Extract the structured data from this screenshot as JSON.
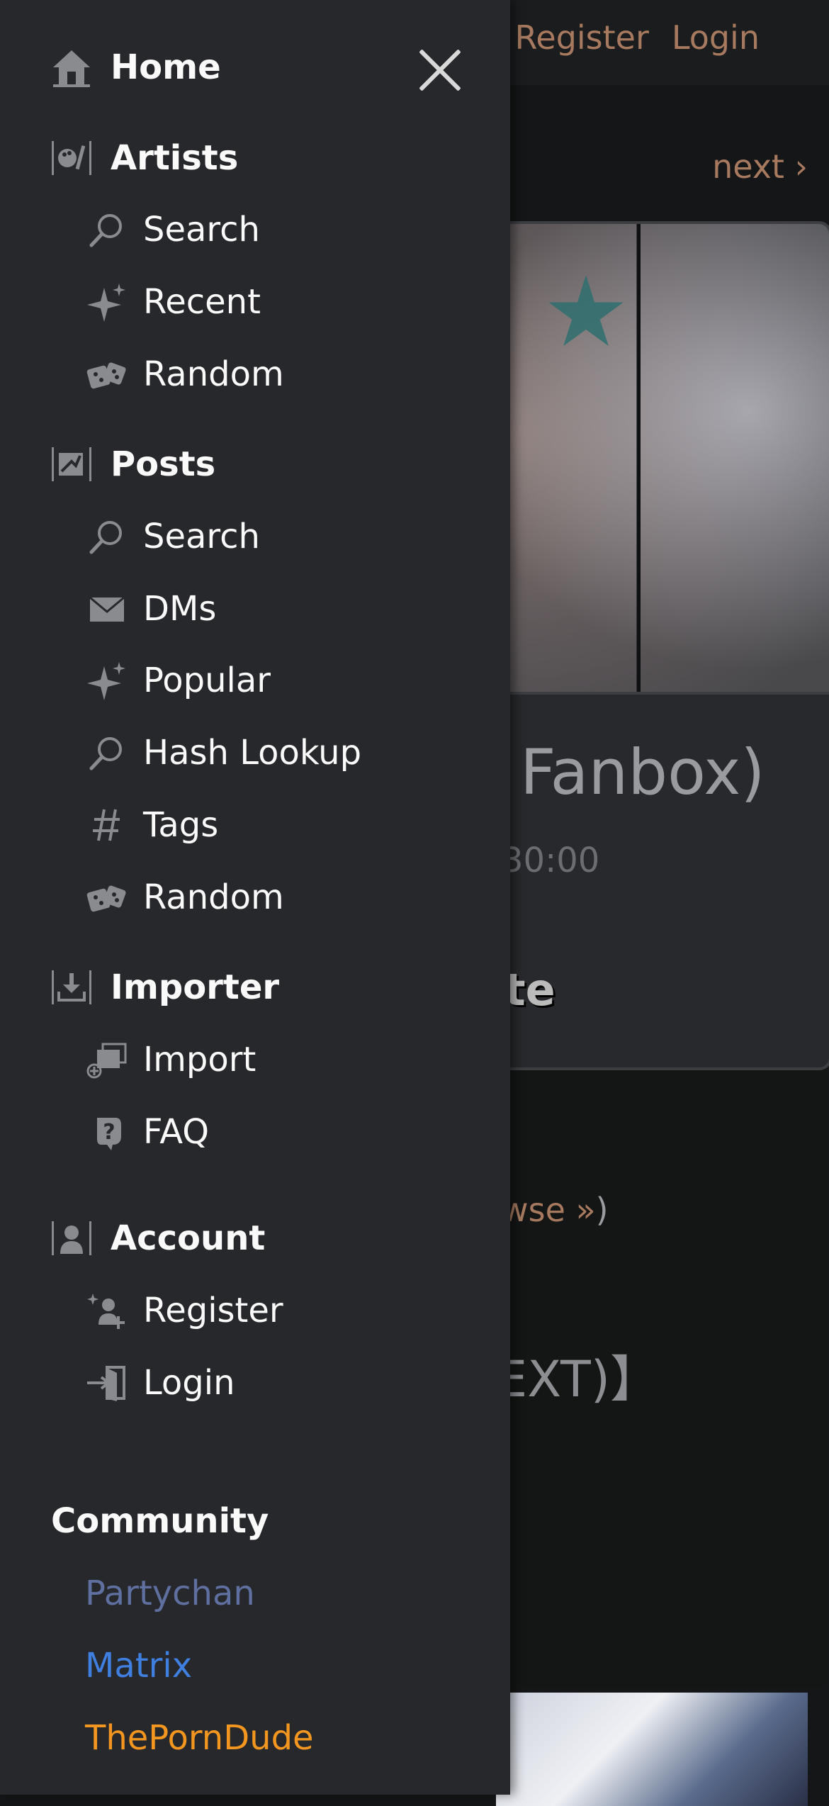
{
  "background": {
    "header_links": [
      "Register",
      "Login"
    ],
    "next_label": "next ›",
    "post_title_fragment": "Fanbox)",
    "post_date_fragment": "30:00",
    "heading_fragment": "te",
    "browse_fragment": "wse »",
    "browse_paren": ")",
    "next_text_fragment": "EXT)】"
  },
  "drawer": {
    "close_icon": "close-icon",
    "home": {
      "label": "Home",
      "icon": "home-icon"
    },
    "artists": {
      "label": "Artists",
      "icon": "palette-icon",
      "items": [
        {
          "label": "Search",
          "icon": "search-icon"
        },
        {
          "label": "Recent",
          "icon": "sparkle-icon"
        },
        {
          "label": "Random",
          "icon": "dice-icon"
        }
      ]
    },
    "posts": {
      "label": "Posts",
      "icon": "posts-icon",
      "items": [
        {
          "label": "Search",
          "icon": "search-icon"
        },
        {
          "label": "DMs",
          "icon": "envelope-icon"
        },
        {
          "label": "Popular",
          "icon": "sparkle-icon"
        },
        {
          "label": "Hash Lookup",
          "icon": "search-icon"
        },
        {
          "label": "Tags",
          "icon": "hash-icon"
        },
        {
          "label": "Random",
          "icon": "dice-icon"
        }
      ]
    },
    "importer": {
      "label": "Importer",
      "icon": "download-icon",
      "items": [
        {
          "label": "Import",
          "icon": "import-icon"
        },
        {
          "label": "FAQ",
          "icon": "question-icon"
        }
      ]
    },
    "account": {
      "label": "Account",
      "icon": "account-icon",
      "items": [
        {
          "label": "Register",
          "icon": "register-icon"
        },
        {
          "label": "Login",
          "icon": "login-icon"
        }
      ]
    },
    "community": {
      "label": "Community",
      "links": [
        {
          "label": "Partychan",
          "color": "#5f6fa0"
        },
        {
          "label": "Matrix",
          "color": "#3f7fe0"
        },
        {
          "label": "ThePornDude",
          "color": "#f2961f"
        }
      ]
    }
  }
}
